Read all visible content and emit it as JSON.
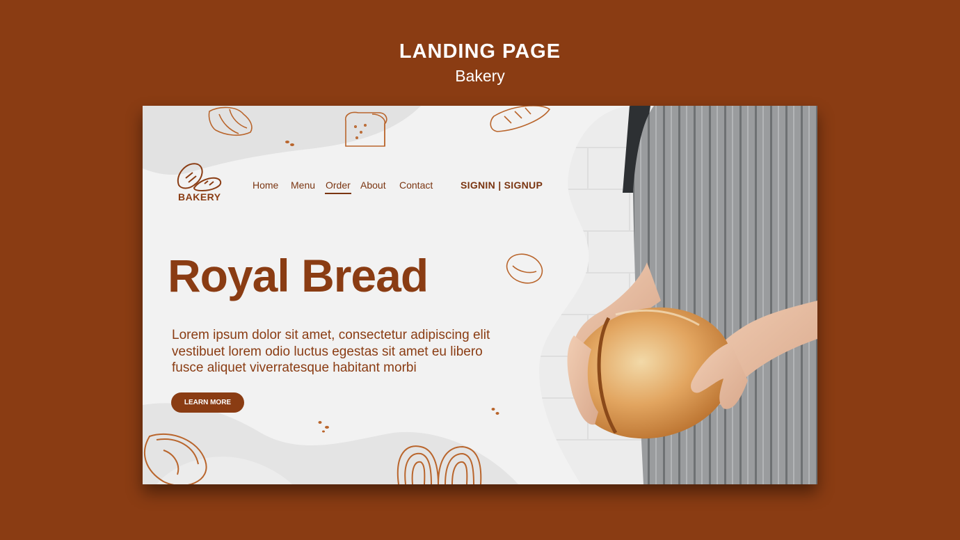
{
  "header": {
    "title": "LANDING PAGE",
    "subtitle": "Bakery"
  },
  "site": {
    "logo_text": "BAKERY",
    "nav": [
      {
        "label": "Home"
      },
      {
        "label": "Menu"
      },
      {
        "label": "Order"
      },
      {
        "label": "About"
      },
      {
        "label": "Contact"
      }
    ],
    "active_nav": "Order",
    "auth_label": "SIGNIN | SIGNUP",
    "hero_title": "Royal Bread",
    "hero_body": "Lorem ipsum dolor sit amet, consectetur adipiscing elit vestibuet lorem odio luctus egestas sit amet eu libero fusce aliquet viverratesque habitant morbi",
    "cta_label": "LEARN MORE"
  },
  "colors": {
    "outer_background": "#8a3c13",
    "brand_brown": "#8a3c13",
    "page_background": "#f2f2f2",
    "doodle_stroke": "#b9652c"
  },
  "icons": [
    "bread-logo-icon",
    "croissant-doodle-icon",
    "toast-doodle-icon",
    "baguette-doodle-icon",
    "bun-doodle-icon",
    "pretzel-doodle-icon",
    "pastry-doodle-icon"
  ]
}
